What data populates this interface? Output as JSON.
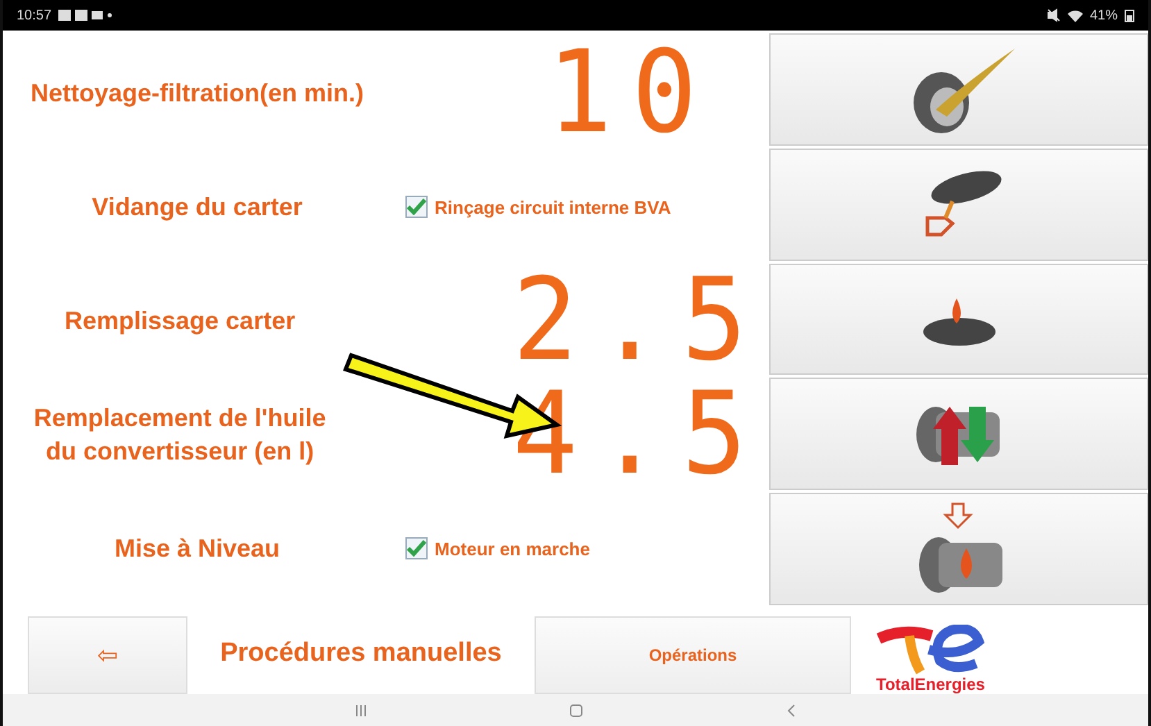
{
  "status_bar": {
    "time": "10:57",
    "battery": "41%"
  },
  "rows": [
    {
      "kind": "value",
      "label": "Nettoyage-filtration(en min.)",
      "value": "10"
    },
    {
      "kind": "option",
      "label": "Vidange du carter",
      "option": {
        "label": "Rinçage circuit interne BVA",
        "checked": true
      }
    },
    {
      "kind": "value",
      "label": "Remplissage carter",
      "value": "2.5"
    },
    {
      "kind": "value",
      "label": "Remplacement de l'huile du convertisseur (en l)",
      "value": "4.5"
    },
    {
      "kind": "option",
      "label": "Mise à Niveau",
      "option": {
        "label": "Moteur en marche",
        "checked": true
      }
    }
  ],
  "footer": {
    "back_button": "⇦",
    "title": "Procédures manuelles",
    "tab": "Opérations",
    "logo_text": "TotalEnergies"
  }
}
